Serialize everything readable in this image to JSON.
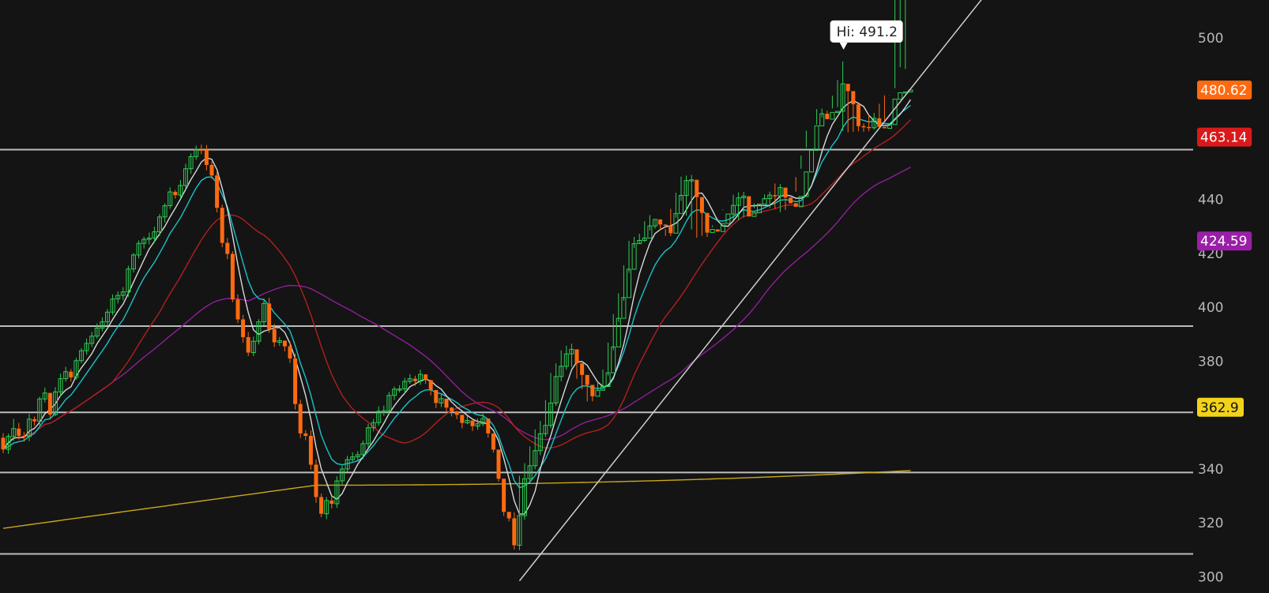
{
  "chart_data": {
    "type": "candlestick",
    "y_axis": {
      "ticks": [
        300,
        320,
        340,
        360,
        380,
        400,
        420,
        440,
        460,
        480,
        500
      ],
      "tick_labels": [
        "300",
        "320",
        "340",
        "",
        "380",
        "400",
        "420",
        "440",
        "",
        "",
        "500"
      ],
      "range": [
        294,
        514
      ],
      "side": "right"
    },
    "colors": {
      "background": "#141414",
      "up": "#2ecc55",
      "down": "#ff6a10",
      "sma_fast": "#d8d8d8",
      "ema": "#19c2cc",
      "sma_50": "#b31f1f",
      "sma_100": "#8e1f9a",
      "sma_200": "#c9a81a",
      "level_line": "#bdbdbd",
      "trend_line": "#cfcfcf"
    },
    "price_labels": [
      {
        "text": "480.62",
        "value": 480.62,
        "bg": "#ff6a10",
        "fg": "#ffffff"
      },
      {
        "text": "463.14",
        "value": 463.14,
        "bg": "#d91a1a",
        "fg": "#ffffff"
      },
      {
        "text": "424.59",
        "value": 424.59,
        "bg": "#9a1fa8",
        "fg": "#ffffff"
      },
      {
        "text": "362.9",
        "value": 362.9,
        "bg": "#f2d21a",
        "fg": "#111111"
      }
    ],
    "annotation": {
      "text": "Hi: 491.2",
      "value": 491.2
    },
    "horizontal_levels": [
      458.5,
      393,
      361,
      338.7,
      308.5
    ],
    "trend_line": {
      "from": {
        "bar": 99,
        "price": 298.5
      },
      "to": {
        "bar": 190,
        "price": 520
      }
    },
    "bar_count": 175,
    "candles": {
      "open": [
        351.6,
        347.3,
        352.1,
        355,
        352.3,
        352.1,
        358.5,
        357.7,
        366,
        368.2,
        360.2,
        368.6,
        373.5,
        376.1,
        374,
        380.2,
        383.9,
        386.6,
        389.3,
        392.3,
        394.6,
        398.2,
        403.1,
        404.4,
        405.7,
        414.2,
        419.4,
        423.7,
        425.2,
        425.7,
        428,
        433.5,
        437.7,
        442.8,
        441.6,
        445.2,
        451.4,
        455.9,
        458.5,
        458.4,
        452.8,
        448.9,
        436.9,
        423.9,
        419.8,
        402.9,
        395.5,
        388.9,
        383.2,
        387.4,
        394.6,
        401.4,
        391.9,
        387,
        387.6,
        385.5,
        381,
        364.1,
        353.2,
        352.3,
        341.6,
        329.6,
        323.4,
        328.3,
        327.1,
        335.6,
        340,
        343.5,
        344.5,
        345.3,
        349.4,
        355.3,
        357.2,
        361.4,
        361.6,
        367.3,
        369.6,
        369.7,
        372.5,
        373.5,
        372.6,
        375.1,
        373,
        369.3,
        364.5,
        366.1,
        362.8,
        361.4,
        360.1,
        357.1,
        358,
        355.9,
        356.8,
        358.7,
        353.2,
        347.2,
        336.4,
        324.1,
        321.7,
        311.7,
        322.7,
        336.4,
        341.2,
        346.8,
        353.1,
        356.2,
        364.5,
        374.3,
        378.1,
        382.7,
        384.4,
        379.2,
        374.9,
        371.2,
        367,
        369.2,
        370.6,
        375.7,
        385.3,
        395.9,
        403.6,
        414.1,
        423.6,
        424.8,
        425.7,
        430.2,
        432.6,
        430.7,
        430.2,
        427.5,
        434.8,
        441.5,
        447,
        447.3,
        440.9,
        435,
        427.7,
        428.9,
        428.1,
        431.1,
        434.6,
        437.8,
        440.6,
        441.2,
        433.7,
        435.1,
        438.3,
        440.3,
        441.6,
        441.3,
        444.4,
        440.7,
        438.6,
        437.3,
        441.1,
        450.2,
        458.2,
        467.3,
        471.8,
        469.8,
        472.3,
        472.7,
        482.9,
        480.2,
        475.3,
        467.2,
        466.9,
        466.6,
        470.1,
        466.9,
        466.4,
        467.8,
        477.2,
        479.6,
        479.9
      ],
      "close": [
        347.3,
        352.1,
        355,
        352.3,
        352.1,
        358.5,
        357.7,
        366,
        368.2,
        360.2,
        368.6,
        373.5,
        376.1,
        374,
        380.2,
        383.9,
        386.6,
        389.3,
        392.3,
        394.6,
        398.2,
        403.1,
        404.4,
        405.7,
        414.2,
        419.4,
        423.7,
        425.2,
        425.7,
        428,
        433.5,
        437.7,
        442.8,
        441.6,
        445.2,
        451.4,
        455.9,
        458.5,
        458.4,
        452.8,
        448.9,
        436.9,
        423.9,
        419.8,
        402.9,
        395.5,
        388.9,
        383.2,
        387.4,
        394.6,
        401.4,
        391.9,
        387,
        387.6,
        385.5,
        381,
        364.1,
        353.2,
        352.3,
        341.6,
        329.6,
        323.4,
        328.3,
        327.1,
        335.6,
        340,
        343.5,
        344.5,
        345.3,
        349.4,
        355.3,
        357.2,
        361.4,
        361.6,
        367.3,
        369.6,
        369.7,
        372.5,
        373.5,
        372.6,
        375.1,
        373,
        369.3,
        364.5,
        366.1,
        362.8,
        361.4,
        360.1,
        357.1,
        358,
        355.9,
        356.8,
        358.7,
        353.2,
        347.2,
        336.4,
        324.1,
        321.7,
        311.7,
        322.7,
        336.4,
        341.2,
        346.8,
        353.1,
        356.2,
        364.5,
        374.3,
        378.1,
        382.7,
        384.4,
        379.2,
        374.9,
        371.2,
        367,
        369.2,
        370.6,
        375.7,
        385.3,
        395.9,
        403.6,
        414.1,
        423.6,
        424.8,
        425.7,
        430.2,
        432.6,
        430.7,
        430.2,
        427.5,
        434.8,
        441.5,
        447,
        447.3,
        440.9,
        435,
        427.7,
        428.9,
        428.1,
        431.1,
        434.6,
        437.8,
        440.6,
        441.2,
        433.7,
        435.1,
        438.3,
        440.3,
        441.6,
        441.3,
        444.4,
        440.7,
        438.6,
        437.3,
        441.1,
        450.2,
        458.2,
        467.3,
        471.8,
        469.8,
        472.3,
        472.7,
        482.9,
        480.2,
        475.3,
        467.2,
        466.9,
        466.6,
        470.1,
        466.9,
        466.4,
        467.8,
        477.2,
        479.6,
        479.9,
        480.6
      ],
      "high": [
        353.3,
        353.1,
        358.6,
        357.1,
        353.7,
        360.5,
        359.5,
        366.8,
        370.2,
        368.3,
        370.4,
        375.4,
        377.9,
        377.1,
        381.2,
        384.9,
        388.4,
        390.9,
        394,
        396.3,
        399.4,
        404.8,
        405.9,
        407.5,
        415.4,
        420.1,
        424.8,
        426.2,
        427.7,
        429.9,
        434.6,
        438.6,
        444.5,
        443.5,
        447.2,
        453.3,
        457.1,
        460,
        460.3,
        460.2,
        454.1,
        450.1,
        438.1,
        425.7,
        420.8,
        404.8,
        397.2,
        390.8,
        389.1,
        395.6,
        403.2,
        403.5,
        393.8,
        389,
        387.7,
        387.3,
        382.8,
        365.7,
        354.4,
        354.3,
        343.5,
        330.9,
        329.6,
        330.1,
        337.3,
        341.3,
        344.9,
        346.2,
        346.6,
        350.6,
        356.8,
        358.5,
        363.2,
        363.5,
        368.6,
        370.6,
        371.1,
        373.8,
        375.2,
        374.6,
        376.8,
        375,
        371,
        366.1,
        367.7,
        365.2,
        363,
        361.6,
        359,
        359.7,
        357.5,
        358.7,
        360.5,
        355.3,
        349.1,
        338,
        325.6,
        323.5,
        323.9,
        337.5,
        342.2,
        348.4,
        354.7,
        357.8,
        365.6,
        375.6,
        379.2,
        384,
        385.7,
        386.5,
        381.1,
        376.9,
        372.9,
        370.8,
        372.5,
        376.9,
        386.9,
        397.5,
        405.2,
        415.6,
        424.6,
        426.1,
        427.3,
        431.9,
        434.2,
        432.6,
        432.3,
        429,
        436.5,
        442.5,
        448.5,
        448.9,
        449.1,
        442.4,
        436.9,
        429.9,
        430.4,
        432.1,
        436.3,
        439.1,
        441.7,
        442.6,
        442.8,
        435.9,
        436.8,
        439.6,
        441.9,
        442.9,
        445.9,
        445.7,
        442.4,
        439.8,
        442.9,
        451.4,
        459.3,
        468.5,
        473.5,
        473.7,
        472.9,
        473.8,
        484.3,
        491.2,
        482.3,
        477.1,
        468.7,
        468.2,
        471.4,
        472.1,
        468.5,
        469.3,
        478.7,
        481.3,
        489,
        488.4
      ],
      "low": [
        345.8,
        345.6,
        350.5,
        350.9,
        350.2,
        350.3,
        356.1,
        356.2,
        364.7,
        358.9,
        359.6,
        366.8,
        372.4,
        372.4,
        373.1,
        379.2,
        382.4,
        385.3,
        388.3,
        391.1,
        393.3,
        397.1,
        401.4,
        402.7,
        403.9,
        412.9,
        418.1,
        421.8,
        423.3,
        423.9,
        426.5,
        431.5,
        436.5,
        440.3,
        440.2,
        443.9,
        449.5,
        454.7,
        456.8,
        450.8,
        447.6,
        435.2,
        422.3,
        417.8,
        401.9,
        394.1,
        386.9,
        381.9,
        381.9,
        386.2,
        393.3,
        390.5,
        385.3,
        385.7,
        383.6,
        379.4,
        362.1,
        351.5,
        350.7,
        339.8,
        327.5,
        322.1,
        321.4,
        325.4,
        325.6,
        334.3,
        338.9,
        342.7,
        343.3,
        343.6,
        347.9,
        354,
        356,
        359.7,
        360.1,
        365.6,
        368.4,
        368.1,
        371.6,
        370.8,
        371.2,
        371.6,
        367.3,
        362.6,
        363,
        361.1,
        359.5,
        358.5,
        355.1,
        356.6,
        354.1,
        354.5,
        355.9,
        351.7,
        346.1,
        335.3,
        322.6,
        320.6,
        310.1,
        309.9,
        321.2,
        334.7,
        339.9,
        345.1,
        351.9,
        355.1,
        363.4,
        372.5,
        376.9,
        377.8,
        373.5,
        369.6,
        365.1,
        365.1,
        368.9,
        369.4,
        374.6,
        384,
        394.6,
        402.4,
        412.8,
        422,
        423.6,
        424.2,
        428.5,
        429.2,
        428.5,
        426.5,
        426.4,
        433.2,
        439.5,
        434,
        428.9,
        425.8,
        426.5,
        426.1,
        429.7,
        432.9,
        436,
        439.2,
        432.4,
        432.3,
        433.3,
        436.8,
        438.6,
        439.6,
        439.9,
        436.8,
        436.6,
        435.3,
        436.1,
        439.6,
        448.3,
        456.3,
        465.5,
        468.5,
        467.8,
        470.4,
        470.8,
        478.5,
        474.2,
        465.4,
        464.9,
        465.1,
        465.3,
        465.1,
        465.3,
        465.9,
        475.5,
        478.6,
        478.6
      ]
    }
  }
}
